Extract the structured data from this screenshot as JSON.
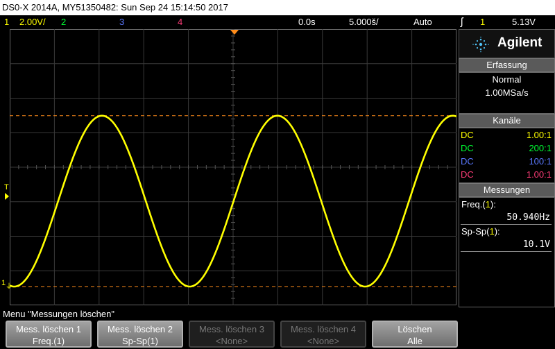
{
  "titlebar": {
    "text": "DS0-X 2014A, MY51350482: Sun Sep 24 15:14:50 2017"
  },
  "status": {
    "ch1_num": "1",
    "ch1_scale": "2.00V/",
    "ch2_num": "2",
    "ch3_num": "3",
    "ch4_num": "4",
    "time_delay": "0.0s",
    "time_scale": "5.000š/",
    "trigger_mode": "Auto",
    "trigger_slope": "ʃ",
    "trigger_channel": "1",
    "trigger_level": "5.13V"
  },
  "scope": {
    "ground_marker": "1",
    "trigger_marker": "T",
    "colors": {
      "trace": "#ffff00",
      "grid": "#3a3a3a",
      "cursor": "#ff8c1a"
    },
    "waveform": {
      "frequency_hz": 50.94,
      "amplitude_vpp": 10.1
    }
  },
  "panel": {
    "brand": "Agilent",
    "acq_header": "Erfassung",
    "acq_mode": "Normal",
    "acq_rate": "1.00MSa/s",
    "channels_header": "Kanäle",
    "channels": [
      {
        "coupling": "DC",
        "probe": "1.00:1",
        "color": "#ffff00"
      },
      {
        "coupling": "DC",
        "probe": "200:1",
        "color": "#00ff33"
      },
      {
        "coupling": "DC",
        "probe": "100:1",
        "color": "#5a78ff"
      },
      {
        "coupling": "DC",
        "probe": "1.00:1",
        "color": "#ff3c78"
      }
    ],
    "meas_header": "Messungen",
    "meas": [
      {
        "label": "Freq.(",
        "ch": "1",
        "close": "):",
        "value": "50.940Hz"
      },
      {
        "label": "Sp-Sp(",
        "ch": "1",
        "close": "):",
        "value": "10.1V"
      }
    ]
  },
  "menu": {
    "title": "Menu \"Messungen löschen\""
  },
  "softkeys": [
    {
      "line1": "Mess. löschen 1",
      "line2": "Freq.(1)",
      "enabled": true
    },
    {
      "line1": "Mess. löschen 2",
      "line2": "Sp-Sp(1)",
      "enabled": true
    },
    {
      "line1": "Mess. löschen 3",
      "line2": "<None>",
      "enabled": false
    },
    {
      "line1": "Mess. löschen 4",
      "line2": "<None>",
      "enabled": false
    },
    {
      "line1": "Löschen",
      "line2": "Alle",
      "enabled": true
    }
  ]
}
